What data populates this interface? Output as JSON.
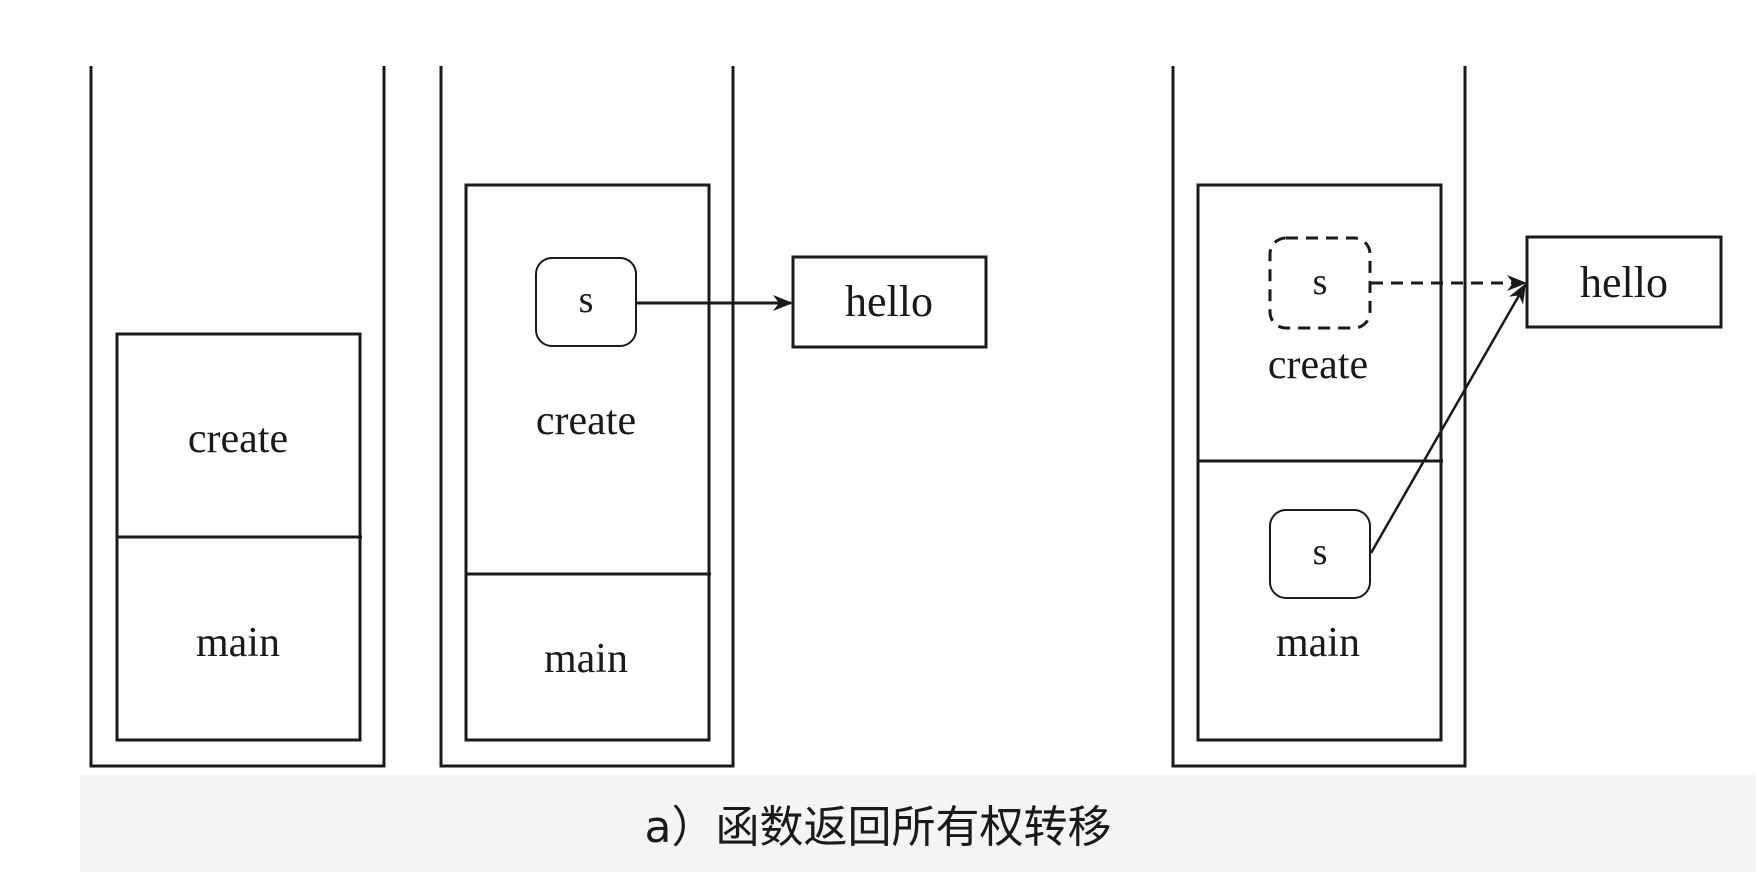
{
  "diagram": {
    "caption": "a）函数返回所有权转移",
    "stack1": {
      "frame_top": "create",
      "frame_bottom": "main"
    },
    "stack2": {
      "var_label": "s",
      "frame_top": "create",
      "frame_bottom": "main",
      "heap_value": "hello"
    },
    "stack3": {
      "var_label_moved": "s",
      "frame_top": "create",
      "var_label": "s",
      "frame_bottom": "main",
      "heap_value": "hello"
    }
  },
  "colors": {
    "stroke": "#1a1a1a",
    "background": "#ffffff",
    "caption_band": "#f4f4f4"
  }
}
